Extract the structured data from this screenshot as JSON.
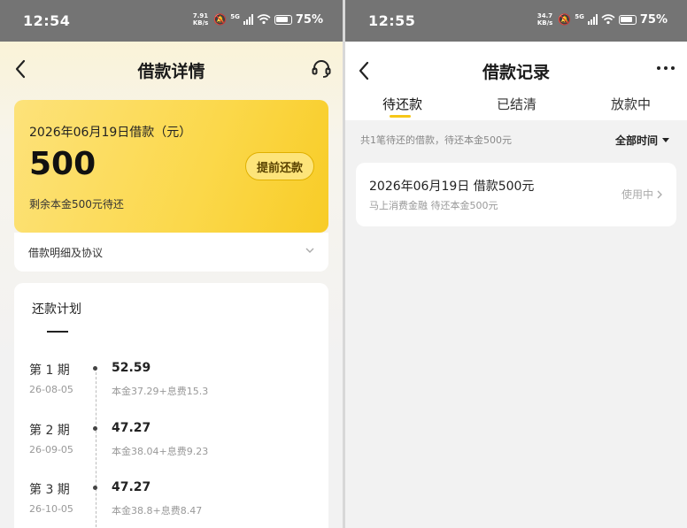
{
  "left": {
    "status": {
      "time": "12:54",
      "speed_value": "7.91",
      "speed_unit": "KB/s",
      "net": "5G",
      "battery": "75%"
    },
    "header": {
      "title": "借款详情"
    },
    "loan": {
      "date_label": "2026年06月19日借款（元）",
      "amount": "500",
      "remaining": "剩余本金500元待还",
      "prepay_label": "提前还款"
    },
    "details_label": "借款明细及协议",
    "plan": {
      "title": "还款计划",
      "items": [
        {
          "period": "第 1 期",
          "date": "26-08-05",
          "amount": "52.59",
          "breakdown": "本金37.29+息费15.3"
        },
        {
          "period": "第 2 期",
          "date": "26-09-05",
          "amount": "47.27",
          "breakdown": "本金38.04+息费9.23"
        },
        {
          "period": "第 3 期",
          "date": "26-10-05",
          "amount": "47.27",
          "breakdown": "本金38.8+息费8.47"
        }
      ]
    }
  },
  "right": {
    "status": {
      "time": "12:55",
      "speed_value": "34.7",
      "speed_unit": "KB/s",
      "net": "5G",
      "battery": "75%"
    },
    "header": {
      "title": "借款记录"
    },
    "tabs": [
      {
        "label": "待还款",
        "active": true
      },
      {
        "label": "已结清",
        "active": false
      },
      {
        "label": "放款中",
        "active": false
      }
    ],
    "summary": "共1笔待还的借款，待还本金500元",
    "filter_label": "全部时间",
    "record": {
      "title": "2026年06月19日 借款500元",
      "subtitle": "马上消费金融 待还本金500元",
      "status": "使用中"
    }
  },
  "colors": {
    "accent": "#f6c718",
    "card_yellow": "#fbd84a",
    "statusbar": "#747474"
  }
}
